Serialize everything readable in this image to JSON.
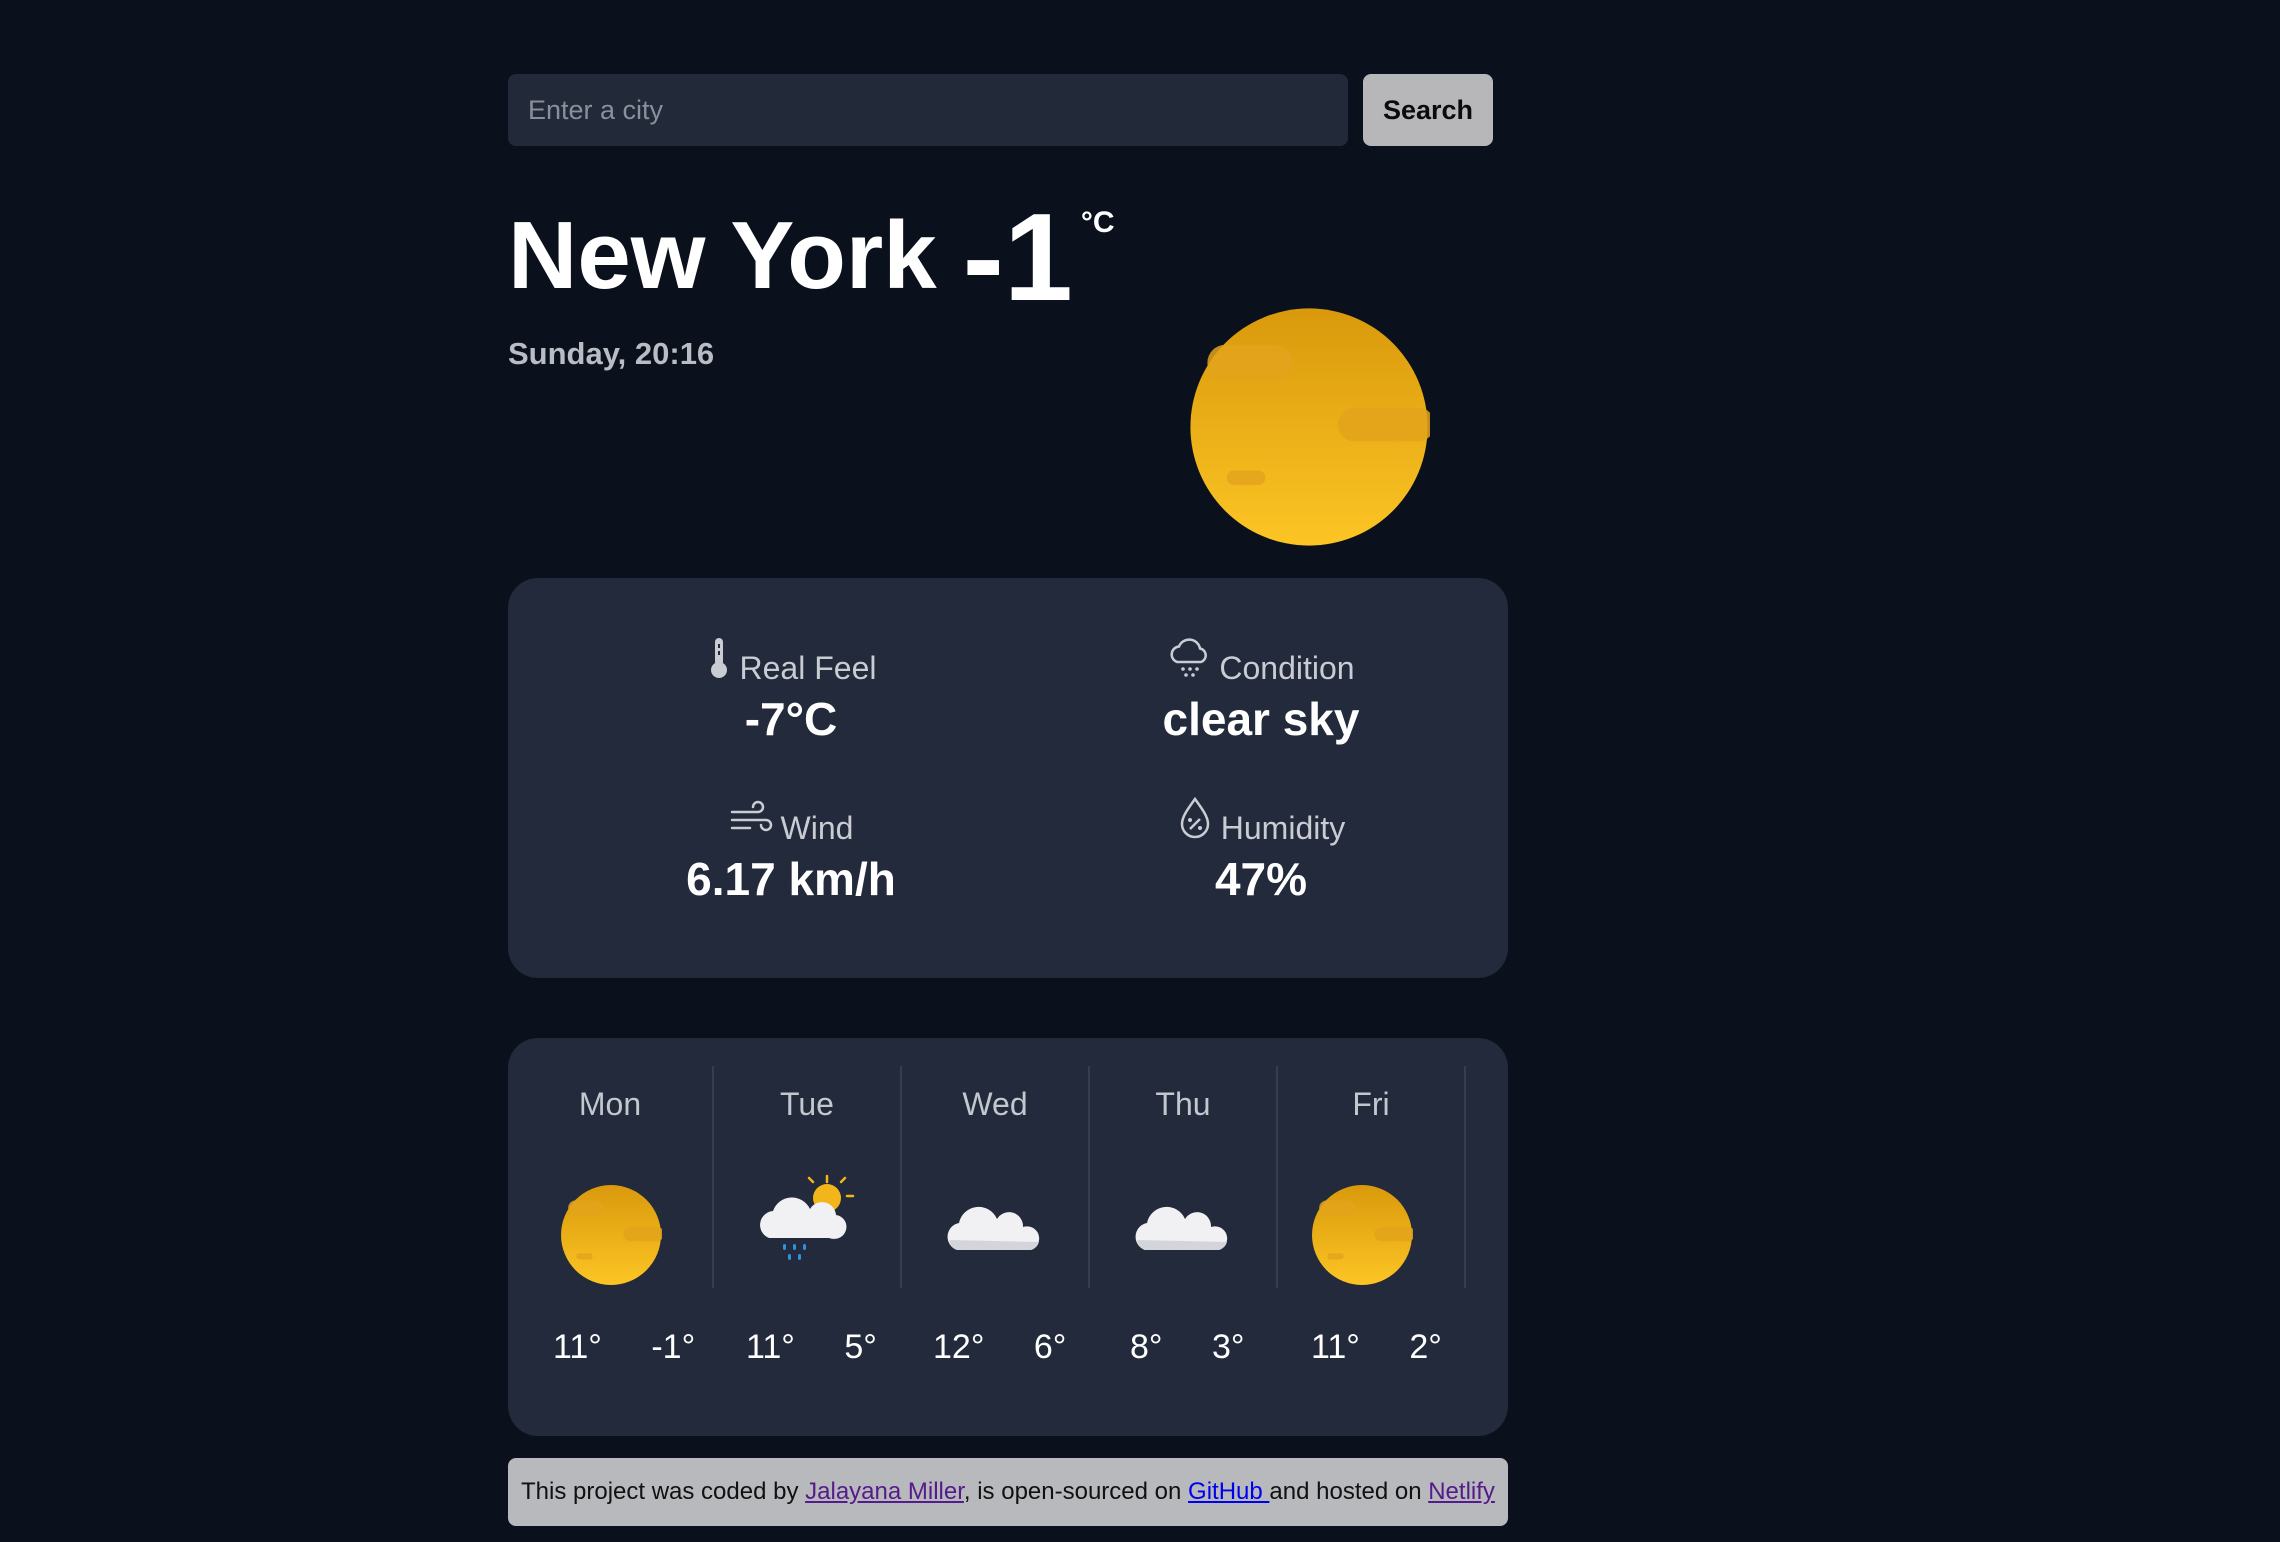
{
  "search": {
    "placeholder": "Enter a city",
    "button_label": "Search"
  },
  "current": {
    "city": "New York",
    "temperature": "-1",
    "unit": "°C",
    "date": "Sunday, 20:16",
    "icon": "sun-icon"
  },
  "details": {
    "real_feel": {
      "label": "Real Feel",
      "value": "-7°C",
      "icon": "thermometer-icon"
    },
    "condition": {
      "label": "Condition",
      "value": "clear sky",
      "icon": "snow-cloud-icon"
    },
    "wind": {
      "label": "Wind",
      "value": "6.17 km/h",
      "icon": "wind-icon"
    },
    "humidity": {
      "label": "Humidity",
      "value": "47%",
      "icon": "humidity-drop-icon"
    }
  },
  "forecast": [
    {
      "day": "Mon",
      "max": "11°",
      "min": "-1°",
      "icon": "sun-icon"
    },
    {
      "day": "Tue",
      "max": "11°",
      "min": "5°",
      "icon": "rain-cloud-sun-icon"
    },
    {
      "day": "Wed",
      "max": "12°",
      "min": "6°",
      "icon": "cloud-icon"
    },
    {
      "day": "Thu",
      "max": "8°",
      "min": "3°",
      "icon": "cloud-icon"
    },
    {
      "day": "Fri",
      "max": "11°",
      "min": "2°",
      "icon": "sun-icon"
    }
  ],
  "footer": {
    "text_1": "This project was coded by ",
    "author_link": "Jalayana Miller",
    "text_2": ", is open-sourced on ",
    "github_link": "GitHub ",
    "text_3": "and hosted on ",
    "netlify_link": "Netlify"
  },
  "colors": {
    "background": "#0b111c",
    "card": "#222a3b",
    "sun": "#f2b51a",
    "footer_bg": "#b8b9bc"
  }
}
